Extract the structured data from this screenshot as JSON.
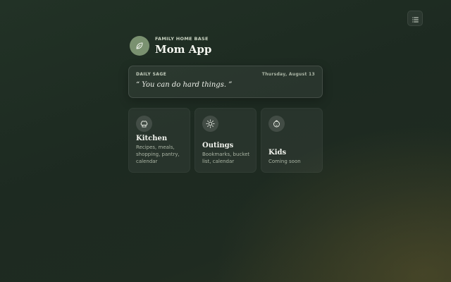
{
  "header": {
    "eyebrow": "FAMILY HOME BASE",
    "title": "Mom App",
    "logo_icon": "leaf-icon"
  },
  "menu": {
    "icon": "list-icon"
  },
  "daily_sage": {
    "label": "DAILY SAGE",
    "date": "Thursday, August 13",
    "quote": "“ You can do hard things. ”"
  },
  "tiles": [
    {
      "title": "Kitchen",
      "description": "Recipes, meals, shopping, pantry, calendar",
      "icon": "chef-hat-icon"
    },
    {
      "title": "Outings",
      "description": "Bookmarks, bucket list, calendar",
      "icon": "sun-icon"
    },
    {
      "title": "Kids",
      "description": "Coming soon",
      "icon": "baby-icon"
    }
  ],
  "colors": {
    "background": "#1f2b21",
    "logo": "#7a9170",
    "text": "#e8ede4"
  }
}
